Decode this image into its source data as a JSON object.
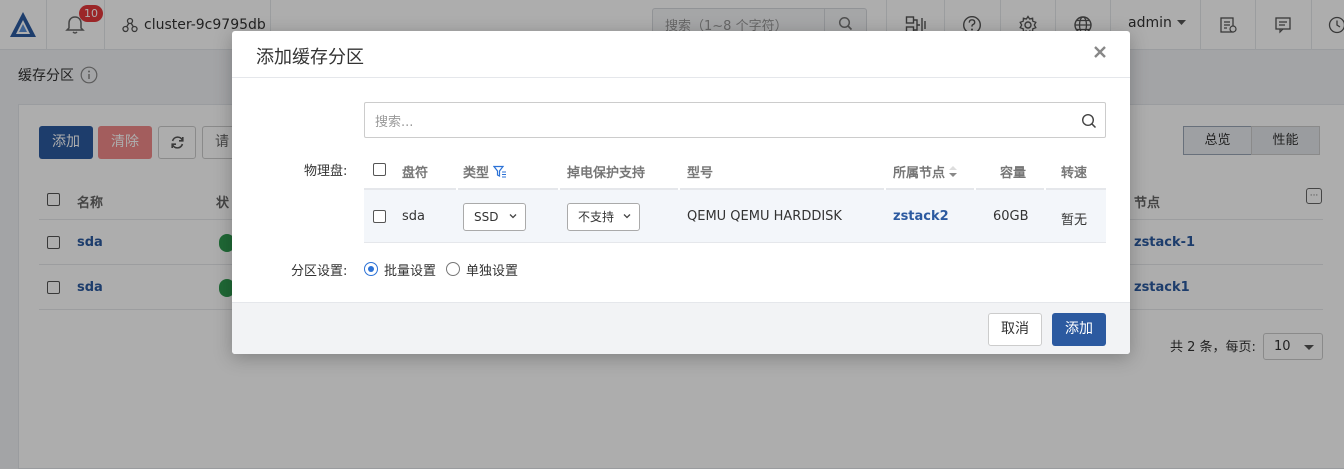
{
  "topbar": {
    "notification_count": "10",
    "cluster_name": "cluster-9c9795db",
    "search_placeholder": "搜索（1~8 个字符）",
    "user": "admin"
  },
  "page": {
    "title": "缓存分区",
    "toolbar": {
      "add": "添加",
      "clear": "清除",
      "more_partial": "请"
    },
    "view_tabs": [
      "总览",
      "性能"
    ],
    "table": {
      "headers": {
        "name": "名称",
        "status": "状",
        "node": "节点"
      },
      "rows": [
        {
          "name": "sda",
          "node": "zstack-1"
        },
        {
          "name": "sda",
          "node": "zstack1"
        }
      ]
    },
    "pagination": {
      "summary": "共 2 条，每页:",
      "page_size": "10"
    }
  },
  "modal": {
    "title": "添加缓存分区",
    "search_placeholder": "搜索...",
    "physical_disk_label": "物理盘:",
    "columns": {
      "disk": "盘符",
      "type": "类型",
      "power_loss": "掉电保护支持",
      "model": "型号",
      "node": "所属节点",
      "capacity": "容量",
      "speed": "转速"
    },
    "rows": [
      {
        "disk": "sda",
        "type": "SSD",
        "power_loss": "不支持",
        "model": "QEMU QEMU HARDDISK",
        "node": "zstack2",
        "capacity": "60GB",
        "speed": "暂无"
      }
    ],
    "partition_label": "分区设置:",
    "partition_options": [
      {
        "label": "批量设置",
        "selected": true
      },
      {
        "label": "单独设置",
        "selected": false
      }
    ],
    "buttons": {
      "cancel": "取消",
      "confirm": "添加"
    }
  },
  "colors": {
    "primary": "#2c5aa0",
    "danger": "#f08a8a",
    "badge": "#e5383b",
    "success": "#2e9a4f"
  }
}
